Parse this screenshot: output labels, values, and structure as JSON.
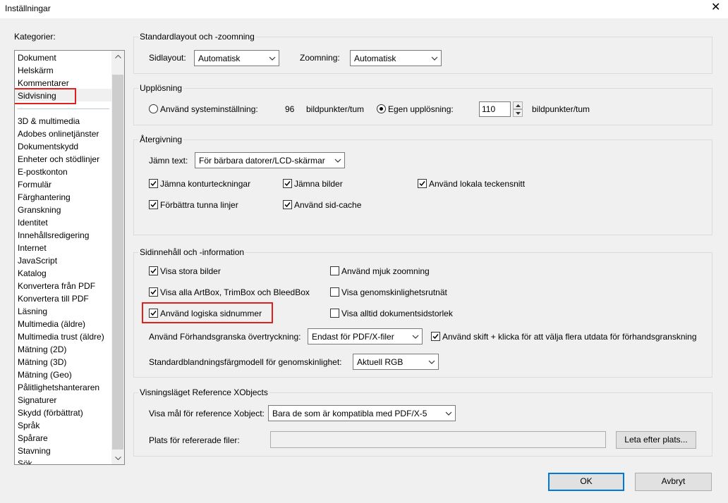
{
  "window": {
    "title": "Inställningar",
    "close_glyph": "✕"
  },
  "categories": {
    "label": "Kategorier:",
    "top_items": [
      "Dokument",
      "Helskärm",
      "Kommentarer",
      "Sidvisning"
    ],
    "items": [
      "3D & multimedia",
      "Adobes onlinetjänster",
      "Dokumentskydd",
      "Enheter och stödlinjer",
      "E-postkonton",
      "Formulär",
      "Färghantering",
      "Granskning",
      "Identitet",
      "Innehållsredigering",
      "Internet",
      "JavaScript",
      "Katalog",
      "Konvertera från PDF",
      "Konvertera till PDF",
      "Läsning",
      "Multimedia (äldre)",
      "Multimedia trust (äldre)",
      "Mätning (2D)",
      "Mätning (3D)",
      "Mätning (Geo)",
      "Pålitlighetshanteraren",
      "Signaturer",
      "Skydd (förbättrat)",
      "Språk",
      "Spårare",
      "Stavning",
      "Sök"
    ],
    "selected": "Sidvisning"
  },
  "layout_zoom": {
    "title": "Standardlayout och -zoomning",
    "page_layout_label": "Sidlayout:",
    "page_layout_value": "Automatisk",
    "zoom_label": "Zoomning:",
    "zoom_value": "Automatisk"
  },
  "resolution": {
    "title": "Upplösning",
    "system_label": "Använd systeminställning:",
    "system_value": "96",
    "unit1": "bildpunkter/tum",
    "custom_label": "Egen upplösning:",
    "custom_value": "110",
    "unit2": "bildpunkter/tum",
    "selected": "custom"
  },
  "rendering": {
    "title": "Återgivning",
    "smooth_text_label": "Jämn text:",
    "smooth_text_value": "För bärbara datorer/LCD-skärmar",
    "smooth_line_art": {
      "label": "Jämna konturteckningar",
      "checked": true
    },
    "smooth_images": {
      "label": "Jämna bilder",
      "checked": true
    },
    "local_fonts": {
      "label": "Använd lokala teckensnitt",
      "checked": true
    },
    "enhance_thin_lines": {
      "label": "Förbättra tunna linjer",
      "checked": true
    },
    "page_cache": {
      "label": "Använd sid-cache",
      "checked": true
    }
  },
  "page_content": {
    "title": "Sidinnehåll och -information",
    "large_images": {
      "label": "Visa stora bilder",
      "checked": true
    },
    "smooth_zoom": {
      "label": "Använd mjuk zoomning",
      "checked": false
    },
    "artbox": {
      "label": "Visa alla ArtBox, TrimBox och BleedBox",
      "checked": true
    },
    "transparency_grid": {
      "label": "Visa genomskinlighetsrutnät",
      "checked": false
    },
    "logical_page_numbers": {
      "label": "Använd logiska sidnummer",
      "checked": true
    },
    "always_show_size": {
      "label": "Visa alltid dokumentsidstorlek",
      "checked": false
    },
    "overprint_label": "Använd Förhandsgranska övertryckning:",
    "overprint_value": "Endast för PDF/X-filer",
    "shift_click": {
      "label": "Använd skift + klicka för att välja flera utdata för förhandsgranskning",
      "checked": true
    },
    "blend_label": "Standardblandningsfärgmodell för genomskinlighet:",
    "blend_value": "Aktuell RGB"
  },
  "xobjects": {
    "title": "Visningsläget Reference XObjects",
    "show_targets_label": "Visa mål för reference Xobject:",
    "show_targets_value": "Bara de som är kompatibla med PDF/X-5",
    "location_label": "Plats för refererade filer:",
    "location_value": "",
    "browse_label": "Leta efter plats..."
  },
  "footer": {
    "ok_label": "OK",
    "cancel_label": "Avbryt"
  },
  "colors": {
    "highlight": "#e0201c",
    "accent": "#0078d7"
  }
}
